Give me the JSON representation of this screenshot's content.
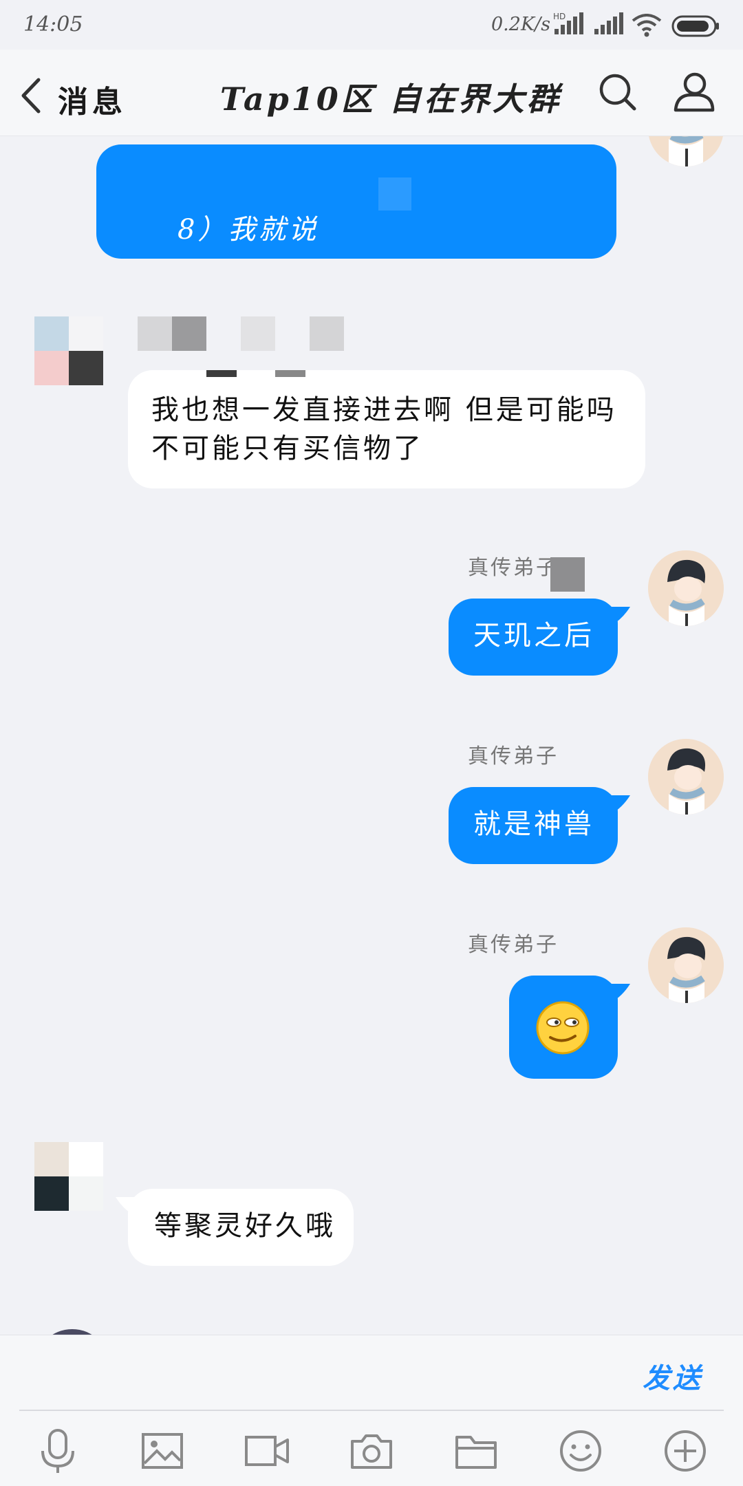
{
  "status_bar": {
    "time": "14:05",
    "net_speed": "0.2K/s",
    "hd_label": "HD"
  },
  "header": {
    "back_label": "消息",
    "title": "Tap10区 自在界大群"
  },
  "messages": [
    {
      "side": "right",
      "kind": "text",
      "text": "8）我就说"
    },
    {
      "side": "left",
      "kind": "text",
      "lines": [
        "我也想一发直接进去啊 但是可能吗",
        "不可能只有买信物了"
      ]
    },
    {
      "side": "right",
      "kind": "text",
      "sender": "真传弟子",
      "text": "天玑之后"
    },
    {
      "side": "right",
      "kind": "text",
      "sender": "真传弟子",
      "text": "就是神兽"
    },
    {
      "side": "right",
      "kind": "emoji",
      "sender": "真传弟子",
      "emoji": "smirk-emoji"
    },
    {
      "side": "left",
      "kind": "text",
      "text": "等聚灵好久哦"
    }
  ],
  "input": {
    "send_label": "发送",
    "toolbar": [
      "microphone-icon",
      "image-icon",
      "video-icon",
      "camera-icon",
      "folder-icon",
      "emoji-icon",
      "plus-icon"
    ]
  },
  "colors": {
    "bubble_blue": "#0a8cff",
    "background": "#f1f2f6",
    "send_blue": "#1e8cff"
  }
}
